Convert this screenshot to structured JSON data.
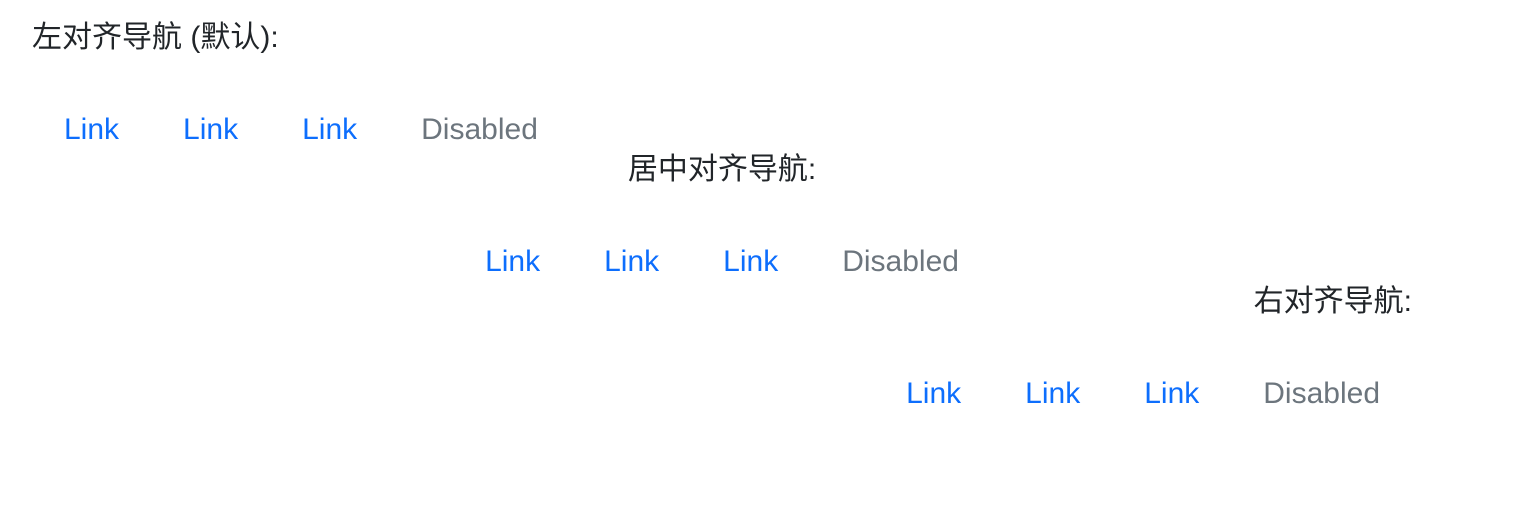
{
  "sections": [
    {
      "label": "左对齐导航 (默认):",
      "links": [
        "Link",
        "Link",
        "Link"
      ],
      "disabled": "Disabled"
    },
    {
      "label": "居中对齐导航:",
      "links": [
        "Link",
        "Link",
        "Link"
      ],
      "disabled": "Disabled"
    },
    {
      "label": "右对齐导航:",
      "links": [
        "Link",
        "Link",
        "Link"
      ],
      "disabled": "Disabled"
    }
  ],
  "colors": {
    "link": "#0d6efd",
    "disabled": "#6c757d",
    "text": "#212529"
  }
}
